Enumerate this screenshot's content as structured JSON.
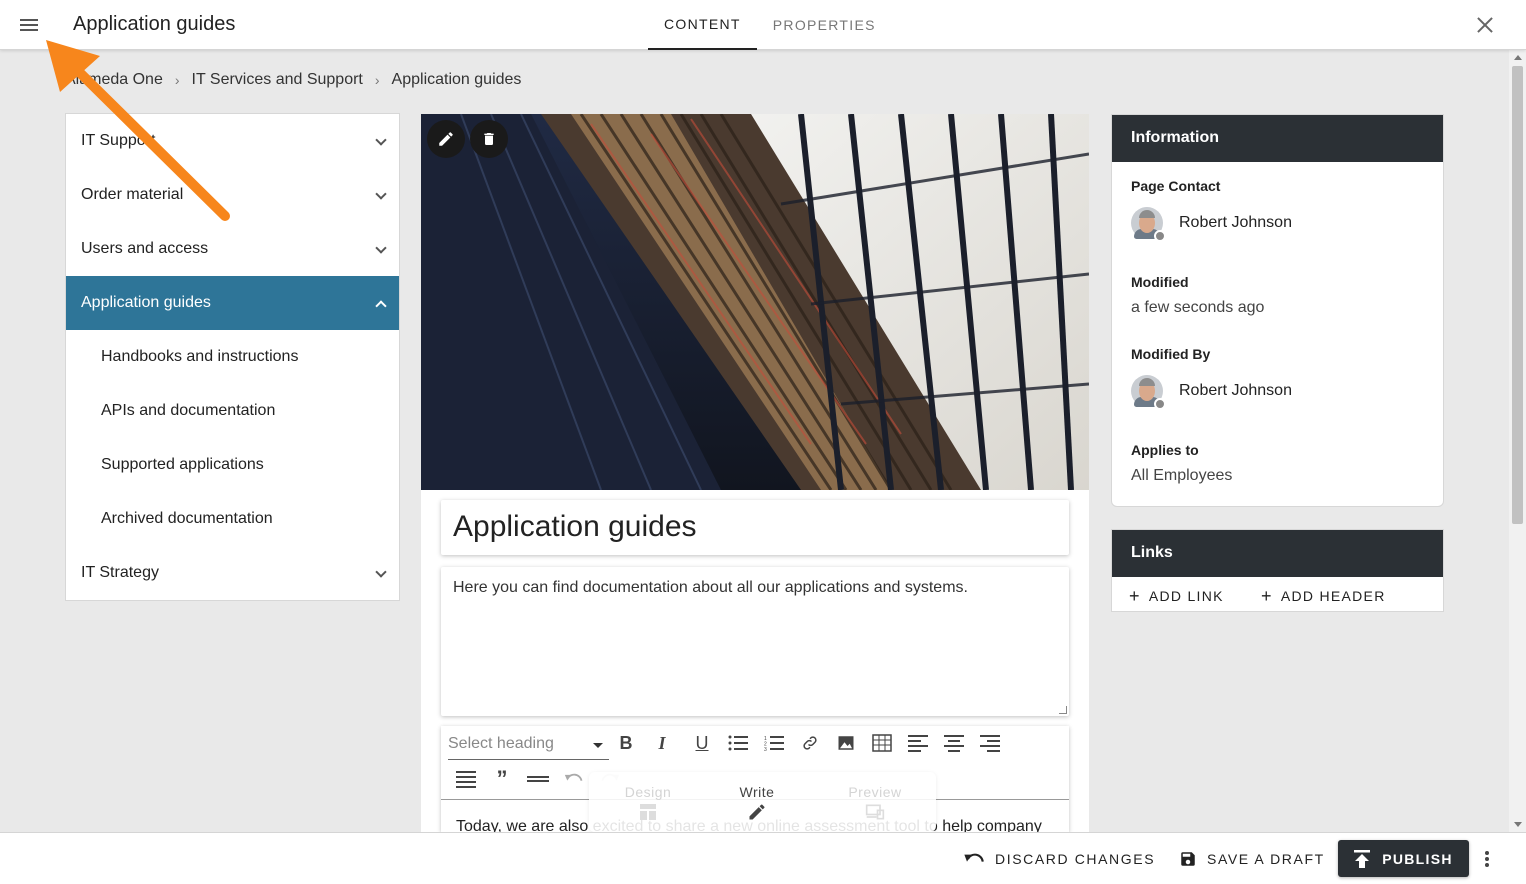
{
  "header": {
    "title": "Application guides",
    "tabs": [
      {
        "label": "CONTENT",
        "active": true
      },
      {
        "label": "PROPERTIES",
        "active": false
      }
    ]
  },
  "breadcrumb": [
    "Alameda One",
    "IT Services and Support",
    "Application guides"
  ],
  "sidebar": {
    "items": [
      {
        "label": "IT Support",
        "expandable": true
      },
      {
        "label": "Order material",
        "expandable": true
      },
      {
        "label": "Users and access",
        "expandable": true
      },
      {
        "label": "Application guides",
        "active": true,
        "expanded": true
      },
      {
        "label": "Handbooks and instructions",
        "sub": true
      },
      {
        "label": "APIs and documentation",
        "sub": true
      },
      {
        "label": "Supported applications",
        "sub": true
      },
      {
        "label": "Archived documentation",
        "sub": true
      },
      {
        "label": "IT Strategy",
        "expandable": true
      }
    ]
  },
  "page": {
    "title": "Application guides",
    "description": "Here you can find documentation about all our applications and systems.",
    "body_text": "Today, we are also excited to share a new online assessment tool to help company"
  },
  "editor": {
    "heading_placeholder": "Select heading",
    "toolbar_icons": [
      "bold-icon",
      "italic-icon",
      "underline-icon",
      "bullet-list-icon",
      "numbered-list-icon",
      "link-icon",
      "image-icon",
      "table-icon",
      "align-left-icon",
      "align-center-icon",
      "align-right-icon",
      "justify-icon",
      "quote-icon",
      "horizontal-rule-icon",
      "undo-icon",
      "redo-icon"
    ],
    "modes": [
      {
        "label": "Design",
        "active": false
      },
      {
        "label": "Write",
        "active": true
      },
      {
        "label": "Preview",
        "active": false
      }
    ]
  },
  "info_panel": {
    "title": "Information",
    "page_contact_label": "Page Contact",
    "page_contact": "Robert Johnson",
    "modified_label": "Modified",
    "modified": "a few seconds ago",
    "modified_by_label": "Modified By",
    "modified_by": "Robert Johnson",
    "applies_to_label": "Applies to",
    "applies_to": "All Employees"
  },
  "links_panel": {
    "title": "Links",
    "add_link": "ADD LINK",
    "add_header": "ADD HEADER"
  },
  "footer": {
    "discard": "DISCARD CHANGES",
    "save_draft": "SAVE A DRAFT",
    "publish": "PUBLISH"
  },
  "colors": {
    "accent": "#2e7598",
    "dark_panel": "#2b3035",
    "annotation_arrow": "#f7861c"
  }
}
